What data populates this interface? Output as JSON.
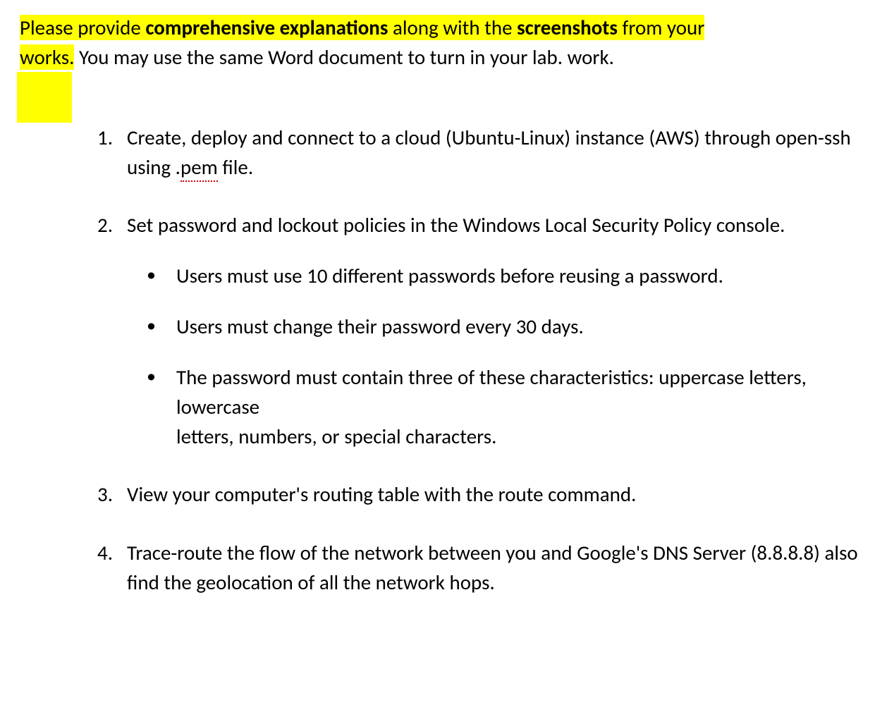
{
  "intro": {
    "part1": "Please provide ",
    "bold1": "comprehensive explanations",
    "part2": " along with the ",
    "bold2": "screenshots",
    "part3": " from your ",
    "part4": "works.",
    "rest": " You may use the same Word document to turn in your lab. work."
  },
  "tasks": [
    {
      "text_before_pem": "Create, deploy and connect to a cloud (Ubuntu-Linux) instance (AWS) through open-ssh using .",
      "pem": "pem",
      "text_after_pem": " file."
    },
    {
      "text": "Set password and lockout policies in the Windows Local Security Policy console.",
      "bullets": [
        "Users must use 10 different passwords before reusing a password.",
        "Users must change their password every 30 days.",
        "The password must contain three of these characteristics: uppercase letters, lowercase\nletters, numbers, or special characters."
      ]
    },
    {
      "text": "View your computer's routing table with the route command."
    },
    {
      "text": "Trace-route the flow of the network between you and Google's DNS Server (8.8.8.8) also find the geolocation of all the network hops."
    }
  ]
}
